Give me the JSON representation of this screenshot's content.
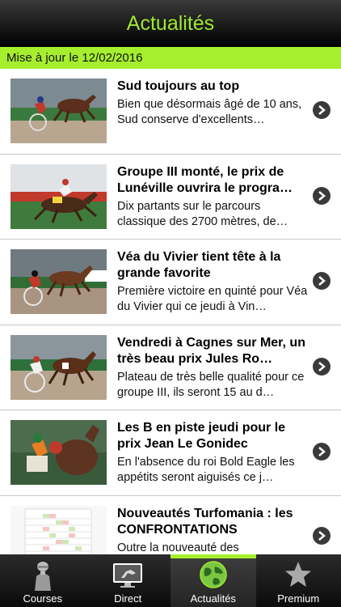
{
  "header": {
    "title": "Actualités"
  },
  "update_bar": {
    "text": "Mise à jour le 12/02/2016"
  },
  "articles": [
    {
      "title": "Sud toujours au top",
      "description": "Bien que désormais âgé de 10 ans, Sud conserve d'excellents…",
      "thumbnail": "harness-racing-photo"
    },
    {
      "title": "Groupe III monté, le prix de Lunéville ouvrira le progra…",
      "description": "Dix partants sur le parcours classique des 2700 mètres, de…",
      "thumbnail": "mounted-trot-photo"
    },
    {
      "title": "Véa du Vivier tient tête à la grande favorite",
      "description": "Première victoire en quinté pour Véa du Vivier qui ce jeudi à Vin…",
      "thumbnail": "harness-racing-photo"
    },
    {
      "title": "Vendredi à Cagnes sur Mer, un très beau prix Jules Ro…",
      "description": "Plateau de très belle qualité pour ce groupe III, ils seront 15 au d…",
      "thumbnail": "harness-racing-photo"
    },
    {
      "title": "Les B en piste jeudi pour le prix Jean Le Gonidec",
      "description": "En l'absence du roi Bold Eagle les appétits seront aiguisés ce j…",
      "thumbnail": "jockey-photo"
    },
    {
      "title": "Nouveautés Turfomania : les CONFRONTATIONS",
      "description": "Outre la nouveauté des",
      "thumbnail": "table-screenshot"
    }
  ],
  "tabs": [
    {
      "label": "Courses",
      "icon": "jockey-icon",
      "active": false
    },
    {
      "label": "Direct",
      "icon": "tv-screen-icon",
      "active": false
    },
    {
      "label": "Actualités",
      "icon": "globe-icon",
      "active": true
    },
    {
      "label": "Premium",
      "icon": "star-icon",
      "active": false
    }
  ],
  "colors": {
    "accent": "#a6ef2e",
    "header_title": "#9fe830",
    "bar_bg": "#000000"
  }
}
